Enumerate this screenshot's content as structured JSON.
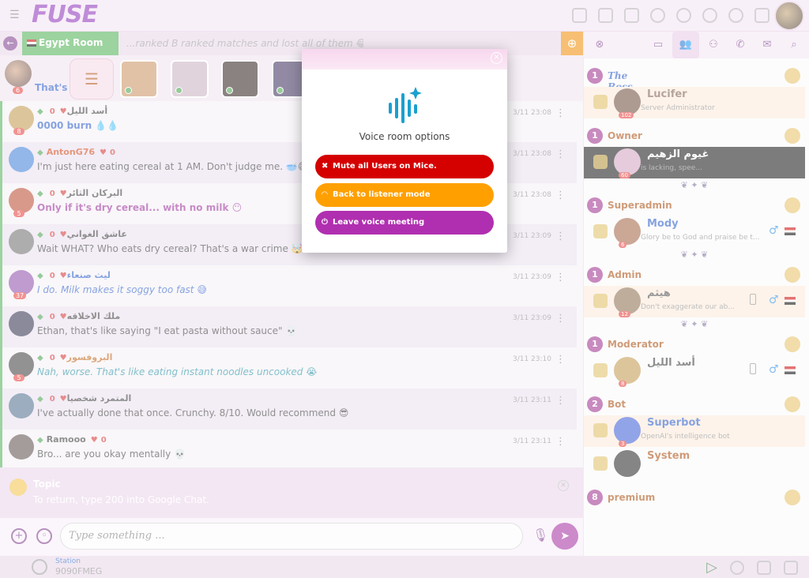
{
  "app": {
    "logo": "FUSE"
  },
  "room": {
    "name": "Egypt Room",
    "scrolling_topic": "...ranked B ranked matches and lost all of them 😂"
  },
  "mic_strip": {
    "self_text": "That's",
    "self_level": "6"
  },
  "chat": {
    "messages": [
      {
        "name": "أسد الليل",
        "name_color": "#333333",
        "likes": "0",
        "level": "8",
        "text": "0000 burn 💧💧",
        "text_color": "#2456c8",
        "text_style": "bold",
        "time": "3/11 23:08",
        "avatar_color": "#c2954a"
      },
      {
        "name": "AntonG76",
        "name_color": "#d04010",
        "likes": "0",
        "level": "",
        "text": "I'm just here eating cereal at 1 AM. Don't judge me. 🥣😅",
        "text_color": "#333333",
        "text_style": "normal",
        "time": "3/11 23:08",
        "avatar_color": "#3a7cd6"
      },
      {
        "name": "البركان الثائر",
        "name_color": "#333333",
        "likes": "0",
        "level": "5",
        "text": "Only if it's dry cereal... with no milk 😶",
        "text_color": "#9a2a9a",
        "text_style": "bold",
        "time": "3/11 23:08",
        "avatar_color": "#b8452a"
      },
      {
        "name": "عاشق الغواني",
        "name_color": "#333333",
        "likes": "0",
        "level": "",
        "text": "Wait WHAT? Who eats dry cereal? That's a war crime 🤯",
        "text_color": "#333333",
        "text_style": "normal",
        "time": "3/11 23:09",
        "avatar_color": "#6a6a6a"
      },
      {
        "name": "ليث صنعاء",
        "name_color": "#2456c8",
        "likes": "0",
        "level": "37",
        "text": "I do. Milk makes it soggy too fast 😅",
        "text_color": "#2456c8",
        "text_style": "italic",
        "time": "3/11 23:09",
        "avatar_color": "#8a4aa8"
      },
      {
        "name": "ملك الاخلاقه",
        "name_color": "#333333",
        "likes": "0",
        "level": "",
        "text": "Ethan, that's like saying \"I eat pasta without sauce\" 💀",
        "text_color": "#333333",
        "text_style": "normal",
        "time": "3/11 23:09",
        "avatar_color": "#2a2a4a"
      },
      {
        "name": "البروفسور",
        "name_color": "#c06010",
        "likes": "0",
        "level": "5",
        "text": "Nah, worse. That's like eating instant noodles uncooked 😭",
        "text_color": "#1a8aa0",
        "text_style": "italic",
        "time": "3/11 23:10",
        "avatar_color": "#3a3a3a"
      },
      {
        "name": "المتمرد شخصيا",
        "name_color": "#333333",
        "likes": "0",
        "level": "",
        "text": "I've actually done that once. Crunchy. 8/10. Would recommend 😎",
        "text_color": "#333333",
        "text_style": "normal",
        "time": "3/11 23:11",
        "avatar_color": "#4a6a8a"
      },
      {
        "name": "Ramooo",
        "name_color": "#333333",
        "likes": "0",
        "level": "",
        "text": "Bro... are you okay mentally 💀",
        "text_color": "#333333",
        "text_style": "normal",
        "time": "3/11 23:11",
        "avatar_color": "#5a4a4a"
      }
    ]
  },
  "topic": {
    "title": "Topic",
    "text": "To return, type 200 into Google Chat."
  },
  "input": {
    "placeholder": "Type something ..."
  },
  "bottombar": {
    "station_label": "Station",
    "station_freq": "9090FMEG"
  },
  "right_panel": {
    "sections": [
      {
        "count": "1",
        "title": "The Boss",
        "users": [
          {
            "name": "Lucifer",
            "status": "Server Administrator",
            "level": "102",
            "avatar_color": "#6a4a3a",
            "name_color": "#7a5a4a"
          }
        ]
      },
      {
        "count": "1",
        "title": "Owner",
        "users": [
          {
            "name": "غيوم الزهيم",
            "status": "is lacking, spee...",
            "level": "60",
            "avatar_color": "#d0a0c0",
            "name_color": "#ffffff"
          }
        ]
      },
      {
        "count": "1",
        "title": "Superadmin",
        "users": [
          {
            "name": "Mody",
            "status": "Glory be to God and praise be t...",
            "level": "6",
            "avatar_color": "#a06040",
            "name_color": "#2456c8"
          }
        ]
      },
      {
        "count": "1",
        "title": "Admin",
        "users": [
          {
            "name": "هيثم",
            "status": "Don't exaggerate our ab...",
            "level": "12",
            "avatar_color": "#8a6a4a",
            "name_color": "#444444"
          }
        ]
      },
      {
        "count": "1",
        "title": "Moderator",
        "users": [
          {
            "name": "أسد الليل",
            "status": "",
            "level": "8",
            "avatar_color": "#c2954a",
            "name_color": "#333333"
          }
        ]
      },
      {
        "count": "2",
        "title": "Bot",
        "users": [
          {
            "name": "Superbot",
            "status": "OpenAI's intelligence bot",
            "level": "3",
            "avatar_color": "#3a5ad6",
            "name_color": "#2456c8"
          },
          {
            "name": "System",
            "status": "",
            "level": "",
            "avatar_color": "#222222",
            "name_color": "#a84a0a"
          }
        ]
      },
      {
        "count": "8",
        "title": "premium",
        "users": []
      }
    ]
  },
  "modal": {
    "title": "Voice room options",
    "buttons": [
      {
        "label": "Mute all Users on Mice.",
        "icon": "mic-off-icon"
      },
      {
        "label": "Back to listener mode",
        "icon": "headset-icon"
      },
      {
        "label": "Leave voice meeting",
        "icon": "power-icon"
      }
    ]
  },
  "colors": {
    "accent": "#a32aa0",
    "room_tab": "#4caf50",
    "mute": "#d50000",
    "listener": "#ffa000",
    "leave": "#b02fb0"
  }
}
